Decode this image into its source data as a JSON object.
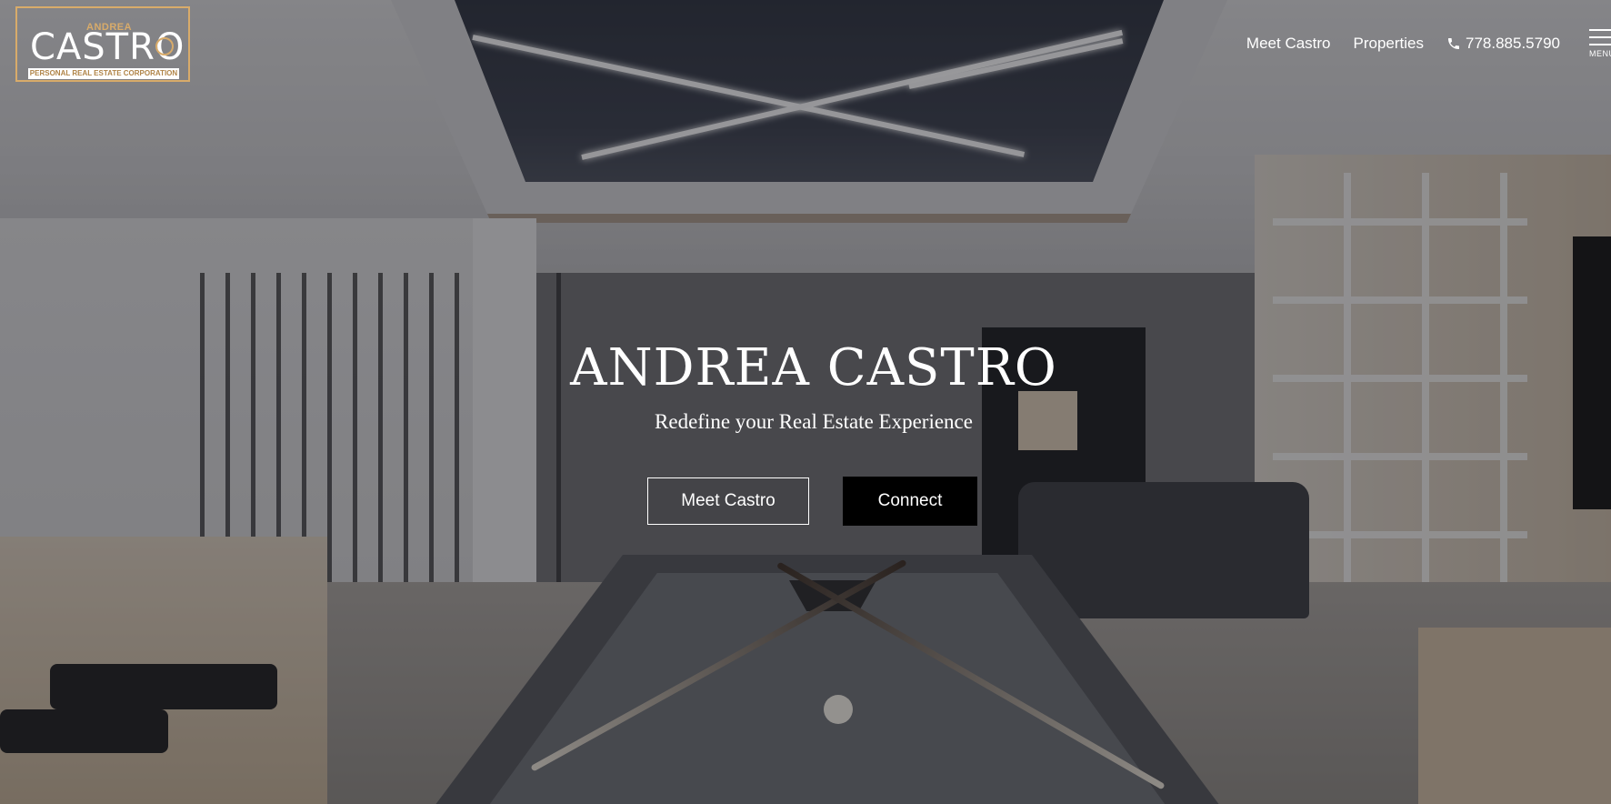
{
  "logo": {
    "small_text": "ANDREA",
    "big_text": "CASTRO",
    "tagline": "PERSONAL REAL ESTATE CORPORATION"
  },
  "nav": {
    "links": [
      "Meet Castro",
      "Properties"
    ],
    "phone": "778.885.5790",
    "menu_label": "MENU"
  },
  "hero": {
    "title": "ANDREA CASTRO",
    "subtitle": "Redefine your Real Estate Experience",
    "primary_button": "Meet Castro",
    "secondary_button": "Connect"
  },
  "colors": {
    "accent": "#d8ab6a",
    "text": "#ffffff",
    "button_solid": "#000000"
  },
  "icons": [
    "phone-icon",
    "hamburger-menu-icon"
  ]
}
